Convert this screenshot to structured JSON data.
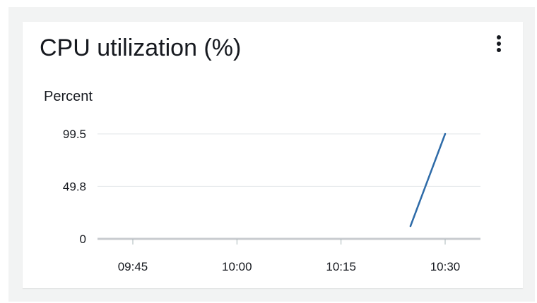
{
  "widget": {
    "title": "CPU utilization (%)",
    "menu_icon": "more-vertical-icon"
  },
  "chart_data": {
    "type": "line",
    "ylabel": "Percent",
    "xlabel": "",
    "x_ticks": [
      "09:45",
      "10:00",
      "10:15",
      "10:30"
    ],
    "y_ticks": [
      0,
      49.8,
      99.5
    ],
    "y_tick_labels": [
      "0",
      "49.8",
      "99.5"
    ],
    "ylim": [
      0,
      99.5
    ],
    "grid": true,
    "series": [
      {
        "color": "#2e6ba8",
        "points": [
          {
            "x": "10:25",
            "y": 12
          },
          {
            "x": "10:30",
            "y": 99.5
          }
        ]
      }
    ]
  }
}
